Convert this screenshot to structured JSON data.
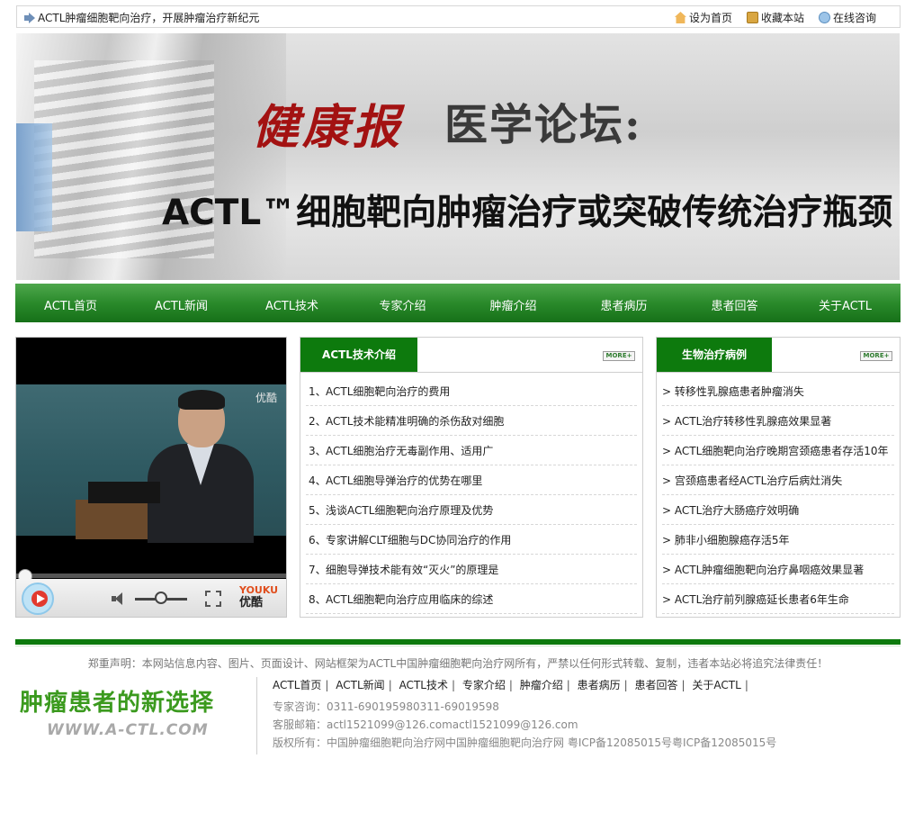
{
  "topbar": {
    "slogan": "ACTL肿瘤细胞靶向治疗，开展肿瘤治疗新纪元",
    "links": [
      {
        "label": "设为首页",
        "icon": "home-icon"
      },
      {
        "label": "收藏本站",
        "icon": "bookmark-icon"
      },
      {
        "label": "在线咨询",
        "icon": "chat-icon"
      }
    ]
  },
  "banner": {
    "title_red": "健康报",
    "title_gray": "医学论坛:",
    "headline": "ACTL™细胞靶向肿瘤治疗或突破传统治疗瓶颈"
  },
  "nav": [
    "ACTL首页",
    "ACTL新闻",
    "ACTL技术",
    "专家介绍",
    "肿瘤介绍",
    "患者病历",
    "患者回答",
    "关于ACTL"
  ],
  "video": {
    "watermark": "优酷",
    "logo_top": "YOUKU",
    "logo_bottom": "优酷"
  },
  "tech_panel": {
    "title": "ACTL技术介绍",
    "more": "MORE+",
    "items": [
      {
        "num": "1、",
        "text": "ACTL细胞靶向治疗的费用"
      },
      {
        "num": "2、",
        "text": "ACTL技术能精准明确的杀伤敌对细胞"
      },
      {
        "num": "3、",
        "text": "ACTL细胞治疗无毒副作用、适用广"
      },
      {
        "num": "4、",
        "text": "ACTL细胞导弹治疗的优势在哪里"
      },
      {
        "num": "5、",
        "text": "浅谈ACTL细胞靶向治疗原理及优势"
      },
      {
        "num": "6、",
        "text": "专家讲解CLT细胞与DC协同治疗的作用"
      },
      {
        "num": "7、",
        "text": "细胞导弹技术能有效“灭火”的原理是"
      },
      {
        "num": "8、",
        "text": "ACTL细胞靶向治疗应用临床的综述"
      }
    ]
  },
  "case_panel": {
    "title": "生物治疗病例",
    "more": "MORE+",
    "items": [
      "> 转移性乳腺癌患者肿瘤消失",
      "> ACTL治疗转移性乳腺癌效果显著",
      "> ACTL细胞靶向治疗晚期宫颈癌患者存活10年",
      "> 宫颈癌患者经ACTL治疗后病灶消失",
      "> ACTL治疗大肠癌疗效明确",
      "> 肺非小细胞腺癌存活5年",
      "> ACTL肿瘤细胞靶向治疗鼻咽癌效果显著",
      "> ACTL治疗前列腺癌延长患者6年生命"
    ]
  },
  "footer": {
    "disclaimer": "郑重声明：本网站信息内容、图片、页面设计、网站框架为ACTL中国肿瘤细胞靶向治疗网所有，严禁以任何形式转载、复制，违者本站必将追究法律责任！",
    "logo_cn": "肿瘤患者的新选择",
    "logo_en": "WWW.A-CTL.COM",
    "links": [
      "ACTL首页",
      "ACTL新闻",
      "ACTL技术",
      "专家介绍",
      "肿瘤介绍",
      "患者病历",
      "患者回答",
      "关于ACTL"
    ],
    "phone": "专家咨询：0311-690195980311-69019598",
    "email": "客服邮箱：actl1521099@126.comactl1521099@126.com",
    "copyright": "版权所有：中国肿瘤细胞靶向治疗网中国肿瘤细胞靶向治疗网 粤ICP备12085015号粤ICP备12085015号"
  }
}
